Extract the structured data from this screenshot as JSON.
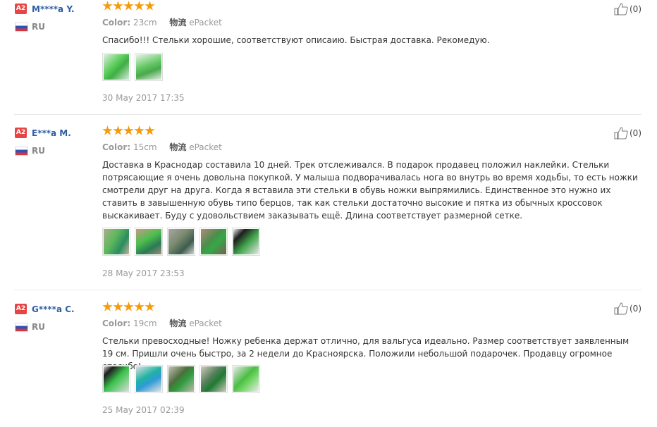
{
  "reviews": [
    {
      "level": "A2",
      "user": "M****a Y.",
      "country": "RU",
      "color_label": "Color:",
      "color_value": "23cm",
      "ship_label": "物流",
      "ship_value": "ePacket",
      "text": "Спасибо!!! Стельки хорошие, соответствуют описаию. Быстрая доставка. Рекомедую.",
      "date": "30 May 2017 17:35",
      "helpful": "(0)",
      "photos": [
        "g1",
        "g2"
      ]
    },
    {
      "level": "A2",
      "user": "E***a M.",
      "country": "RU",
      "color_label": "Color:",
      "color_value": "15cm",
      "ship_label": "物流",
      "ship_value": "ePacket",
      "text": "Доставка в Краснодар составила 10 дней. Трек отслеживался. В подарок продавец положил наклейки. Стельки потрясающие я очень довольна покупкой. У малыша подворачивалась нога во внутрь во время ходьбы, то есть ножки смотрели друг на друга. Когда я вставила эти стельки в обувь ножки выпрямились. Единственное это нужно их ставить в завышенную обувь типо берцов, так как стельки достаточно высокие и пятка из обычных кроссовок выскакивает. Буду с удовольствием заказывать ещё. Длина соответствует размерной сетке.",
      "date": "28 May 2017 23:53",
      "helpful": "(0)",
      "photos": [
        "g3",
        "g4",
        "g5",
        "g6",
        "g7"
      ]
    },
    {
      "level": "A2",
      "user": "G****a C.",
      "country": "RU",
      "color_label": "Color:",
      "color_value": "19cm",
      "ship_label": "物流",
      "ship_value": "ePacket",
      "text": "Стельки превосходные! Ножку ребенка держат отлично, для вальгуса идеально. Размер соответствует заявленным 19 см. Пришли очень быстро, за 2 недели до Красноярска. Положили небольшой подарочек. Продавцу огромное спасибо!",
      "date": "25 May 2017 02:39",
      "helpful": "(0)",
      "photos": [
        "g8",
        "g9",
        "g10",
        "g11",
        "g12"
      ]
    }
  ],
  "rating_stars": 5,
  "colors": {
    "username": "#2e5fa5",
    "level_badge": "#e64545",
    "star": "#f59b0a"
  },
  "icons": {
    "like": "thumbs-up-icon",
    "flag": "flag-ru-icon"
  }
}
